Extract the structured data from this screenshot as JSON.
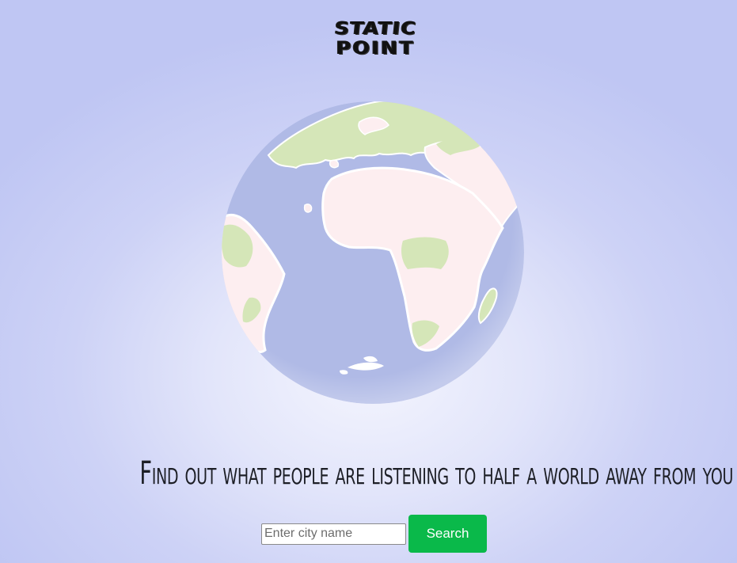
{
  "logo": {
    "line1": "STATIC",
    "line2": "POINT"
  },
  "globe": {
    "icon": "globe-icon",
    "colors": {
      "ocean": "#b0bae6",
      "land": "#fdeef0",
      "vegetation": "#d5e6b8",
      "coast": "#ffffff"
    }
  },
  "tagline": "Find out what people are listening to half a world away from you",
  "search": {
    "value": "",
    "placeholder": "Enter city name",
    "button_label": "Search",
    "button_color": "#0ab94a"
  }
}
